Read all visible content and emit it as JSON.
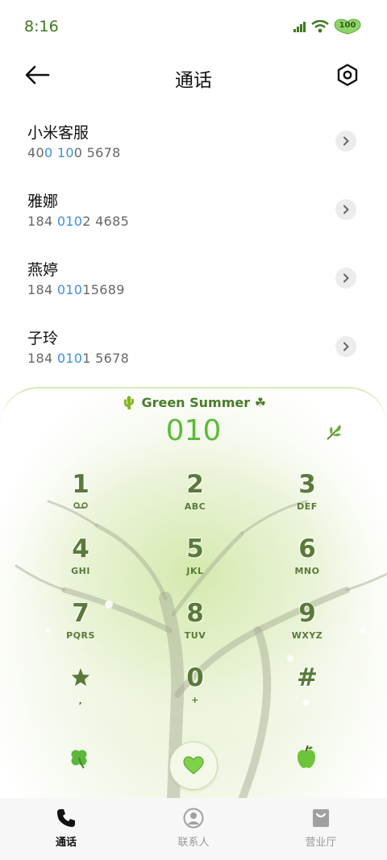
{
  "status": {
    "time": "8:16",
    "battery": "100"
  },
  "header": {
    "title": "通话"
  },
  "calls": [
    {
      "name": "小米客服",
      "number_parts": [
        "40",
        "0 10",
        "0 5678"
      ]
    },
    {
      "name": "雅娜",
      "number_parts": [
        "184 ",
        "010",
        "2 4685"
      ]
    },
    {
      "name": "燕婷",
      "number_parts": [
        "184 ",
        "010",
        "15689"
      ]
    },
    {
      "name": "子玲",
      "number_parts": [
        "184 ",
        "010",
        "1 5678"
      ]
    }
  ],
  "dialpad": {
    "theme_label": "Green Summer",
    "number": "010",
    "keys": [
      {
        "digit": "1",
        "letters": ""
      },
      {
        "digit": "2",
        "letters": "ABC"
      },
      {
        "digit": "3",
        "letters": "DEF"
      },
      {
        "digit": "4",
        "letters": "GHI"
      },
      {
        "digit": "5",
        "letters": "JKL"
      },
      {
        "digit": "6",
        "letters": "MNO"
      },
      {
        "digit": "7",
        "letters": "PQRS"
      },
      {
        "digit": "8",
        "letters": "TUV"
      },
      {
        "digit": "9",
        "letters": "WXYZ"
      },
      {
        "digit": "",
        "letters": ","
      },
      {
        "digit": "0",
        "letters": "+"
      },
      {
        "digit": "#",
        "letters": ""
      }
    ]
  },
  "tabs": [
    {
      "label": "通话",
      "icon": "phone-icon",
      "active": true
    },
    {
      "label": "联系人",
      "icon": "contacts-icon",
      "active": false
    },
    {
      "label": "营业厅",
      "icon": "store-icon",
      "active": false
    }
  ],
  "colors": {
    "accent_green": "#5cbb3b",
    "key_text": "#5a7a3a",
    "highlight_blue": "#3d8fe0",
    "time_green": "#3c7a1e"
  }
}
